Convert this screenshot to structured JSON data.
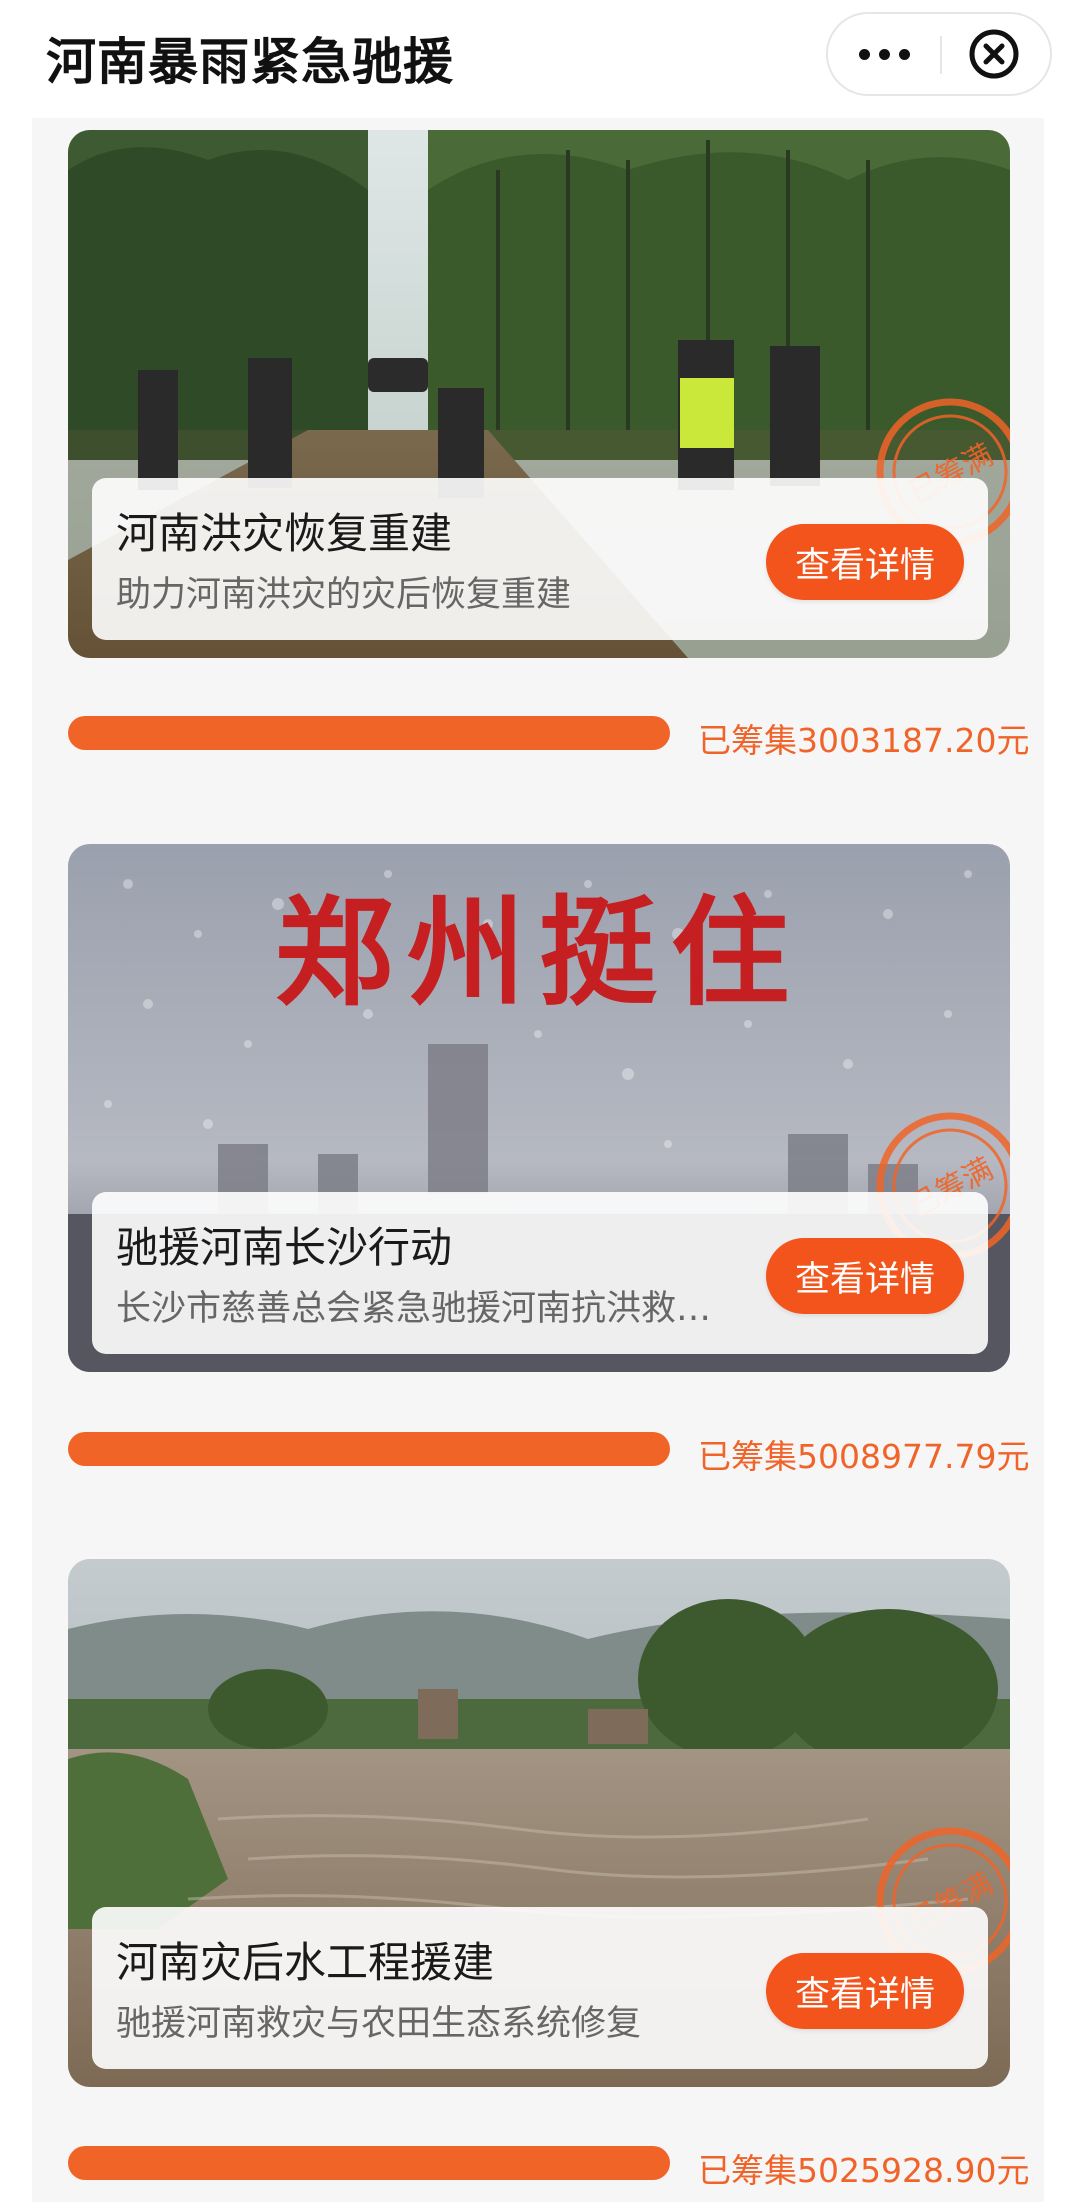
{
  "header": {
    "title": "河南暴雨紧急驰援",
    "more_icon": "more-dots-icon",
    "close_icon": "close-circle-icon"
  },
  "projects": [
    {
      "title": "河南洪灾恢复重建",
      "subtitle": "助力河南洪灾的灾后恢复重建",
      "button_label": "查看详情",
      "stamp_text": "已筹满",
      "raised_text": "已筹集3003187.20元",
      "progress": 1.0
    },
    {
      "title": "驰援河南长沙行动",
      "subtitle": "长沙市慈善总会紧急驰援河南抗洪救…",
      "button_label": "查看详情",
      "stamp_text": "已筹满",
      "raised_text": "已筹集5008977.79元",
      "progress": 1.0,
      "image_text": "郑州挺住"
    },
    {
      "title": "河南灾后水工程援建",
      "subtitle": "驰援河南救灾与农田生态系统修复",
      "button_label": "查看详情",
      "stamp_text": "已筹满",
      "raised_text": "已筹集5025928.90元",
      "progress": 1.0
    }
  ],
  "colors": {
    "accent": "#f2541b",
    "progress": "#f06428",
    "raised_text": "#f0642a",
    "background": "#f6f6f6"
  }
}
